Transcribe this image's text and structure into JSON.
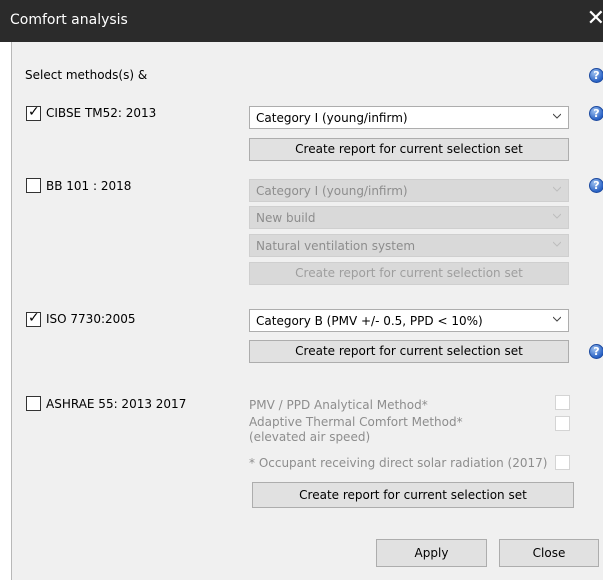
{
  "window": {
    "title": "Comfort analysis",
    "close_glyph": "✕"
  },
  "intro": {
    "label": "Select methods(s) &"
  },
  "help_glyph": "?",
  "cibse": {
    "label": "CIBSE TM52: 2013",
    "checked": true,
    "category": "Category I (young/infirm)",
    "report_label": "Create report for current selection set"
  },
  "bb101": {
    "label": "BB 101 : 2018",
    "checked": false,
    "category": "Category I (young/infirm)",
    "build": "New build",
    "ventilation": "Natural ventilation system",
    "report_label": "Create report for current selection set"
  },
  "iso": {
    "label": "ISO 7730:2005",
    "checked": true,
    "category": "Category B (PMV +/- 0.5, PPD < 10%)",
    "report_label": "Create report for current selection set"
  },
  "ashrae": {
    "label": "ASHRAE 55: 2013  2017",
    "checked": false,
    "pmv_label": "PMV / PPD Analytical Method*",
    "adaptive_label_1": "Adaptive Thermal Comfort Method*",
    "adaptive_label_2": "(elevated air speed)",
    "solar_label": "* Occupant receiving direct solar radiation (2017)",
    "report_label": "Create report for current selection set"
  },
  "footer": {
    "apply_label": "Apply",
    "close_label": "Close"
  },
  "icons": {
    "help": "help-icon",
    "chevron": "chevron-down-icon",
    "check": "checkmark-icon"
  }
}
